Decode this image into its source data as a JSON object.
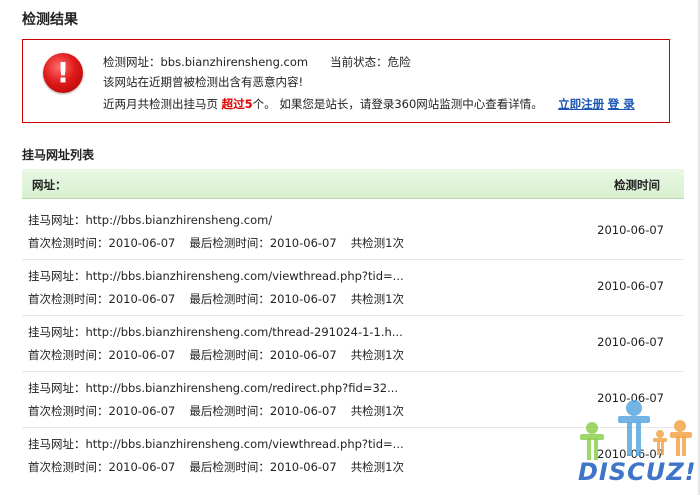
{
  "page_title": "检测结果",
  "alert": {
    "site_label": "检测网址：",
    "site_value": "bbs.bianzhirensheng.com",
    "status_label": "当前状态：",
    "status_value": "危险",
    "line2": "该网站在近期曾被检测出含有恶意内容!",
    "line3_prefix": "近两月共检测出挂马页",
    "line3_highlight": "超过5",
    "line3_suffix": "个。  如果您是站长，请登录360网站监测中心查看详情。",
    "register_link": "立即注册",
    "login_link": "登 录",
    "icon": "exclamation-icon",
    "accent_color": "#cc0000"
  },
  "list": {
    "heading": "挂马网址列表",
    "col_url": "网址：",
    "col_time": "检测时间",
    "header_color": "#dff4d8",
    "rows": [
      {
        "url_label": "挂马网址：http://bbs.bianzhirensheng.com/",
        "first": "首次检测时间：2010-06-07",
        "last": "最后检测时间：2010-06-07",
        "count": "共检测1次",
        "date": "2010-06-07"
      },
      {
        "url_label": "挂马网址：http://bbs.bianzhirensheng.com/viewthread.php?tid=...",
        "first": "首次检测时间：2010-06-07",
        "last": "最后检测时间：2010-06-07",
        "count": "共检测1次",
        "date": "2010-06-07"
      },
      {
        "url_label": "挂马网址：http://bbs.bianzhirensheng.com/thread-291024-1-1.h...",
        "first": "首次检测时间：2010-06-07",
        "last": "最后检测时间：2010-06-07",
        "count": "共检测1次",
        "date": "2010-06-07"
      },
      {
        "url_label": "挂马网址：http://bbs.bianzhirensheng.com/redirect.php?fid=32...",
        "first": "首次检测时间：2010-06-07",
        "last": "最后检测时间：2010-06-07",
        "count": "共检测1次",
        "date": "2010-06-07"
      },
      {
        "url_label": "挂马网址：http://bbs.bianzhirensheng.com/viewthread.php?tid=...",
        "first": "首次检测时间：2010-06-07",
        "last": "最后检测时间：2010-06-07",
        "count": "共检测1次",
        "date": "2010-06-07"
      }
    ]
  },
  "watermark": {
    "text": "DISCUZ!",
    "icon": "discuz-people-logo"
  }
}
